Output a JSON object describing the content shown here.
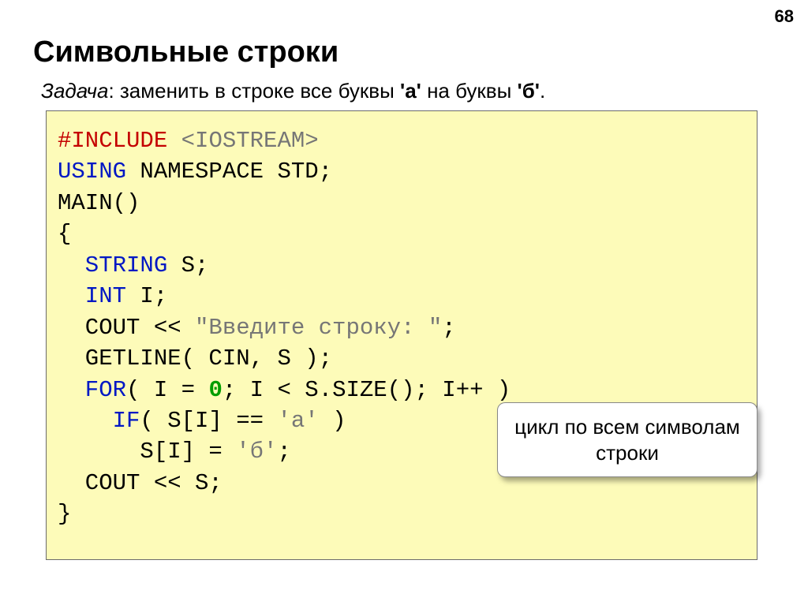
{
  "page_number": "68",
  "heading": "Символьные строки",
  "task": {
    "label": "Задача",
    "sep": ": ",
    "text_1": "заменить в строке все буквы ",
    "char_a": "'а'",
    "text_2": " на буквы ",
    "char_b": "'б'",
    "text_3": "."
  },
  "code": {
    "l1_a": "#INCLUDE ",
    "l1_b": "<IOSTREAM>",
    "l2_a": "USING",
    "l2_b": " NAMESPACE STD;",
    "l3": "MAIN()",
    "l4": "{",
    "l5_a": "  STRING",
    "l5_b": " S;",
    "l6_a": "  INT",
    "l6_b": " I;",
    "l7_a": "  COUT << ",
    "l7_b": "\"Введите строку: \"",
    "l7_c": ";",
    "l8": "  GETLINE( CIN, S );",
    "l9_a": "  FOR",
    "l9_b": "( I = ",
    "l9_c": "0",
    "l9_d": "; I < S.SIZE(); I++ )",
    "l10_a": "    IF",
    "l10_b": "( S[I] == ",
    "l10_c": "'а'",
    "l10_d": " )",
    "l11_a": "      S[I] = ",
    "l11_b": "'б'",
    "l11_c": ";",
    "l12": "  COUT << S;",
    "l13": "}"
  },
  "callout": "цикл по всем символам строки"
}
